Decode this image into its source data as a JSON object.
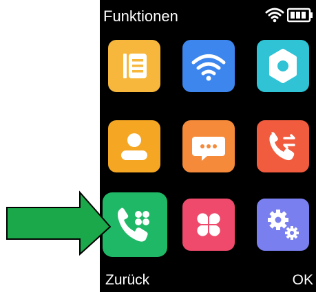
{
  "header": {
    "title": "Funktionen"
  },
  "status": {
    "wifi_icon": "wifi-icon",
    "battery_icon": "battery-icon"
  },
  "softkeys": {
    "left": "Zurück",
    "right": "OK"
  },
  "apps": [
    {
      "name": "notes",
      "icon": "list-icon",
      "color": "#f6b73c"
    },
    {
      "name": "wifi",
      "icon": "wifi-icon",
      "color": "#3d86ee"
    },
    {
      "name": "settings",
      "icon": "gear-icon",
      "color": "#2fc3d5"
    },
    {
      "name": "contacts",
      "icon": "person-icon",
      "color": "#f5a623"
    },
    {
      "name": "messages",
      "icon": "chat-icon",
      "color": "#f58a3a"
    },
    {
      "name": "call-log",
      "icon": "phone-transfer-icon",
      "color": "#f15b3e"
    },
    {
      "name": "speed-dial",
      "icon": "phone-keypad-icon",
      "color": "#1fb866",
      "selected": true
    },
    {
      "name": "extras",
      "icon": "clover-icon",
      "color": "#ef4a6b"
    },
    {
      "name": "advanced-settings",
      "icon": "gears-icon",
      "color": "#7a7ff0"
    }
  ],
  "annotation": {
    "arrow_color": "#1aa84a",
    "arrow_icon": "right-arrow-icon"
  }
}
